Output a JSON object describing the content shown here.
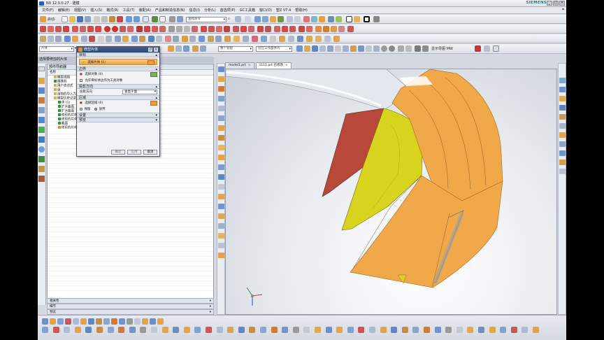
{
  "window": {
    "title": "NX 12.0.0.27 - 建模",
    "brand": "SIEMENS",
    "controls": [
      "_",
      "□",
      "×"
    ]
  },
  "menubar": {
    "items": [
      "文件(F)",
      "编辑(E)",
      "视图(V)",
      "插入(S)",
      "格式(R)",
      "工具(T)",
      "装配(A)",
      "产品和制造信息(N)",
      "信息(I)",
      "分析(L)",
      "首选项(P)",
      "GC工具箱",
      "窗口(O)",
      "塑Z V7.4",
      "帮助(H)"
    ],
    "right_label": "⌗"
  },
  "toolbar1": {
    "start_label": "启动·",
    "find_placeholder": "查找命令",
    "search_glyph": "⌕"
  },
  "toolbar3": {
    "filter_value": "片体",
    "scope_value": "仅在工作部件内",
    "snap_label": "整个装配",
    "view_label": "显示导图 MW"
  },
  "selection_bar": {
    "type_filter": "片体",
    "scope": "整个装配"
  },
  "navigator": {
    "panel_title": "选择要修剪的片体",
    "header": "部件导航器",
    "column_name": "名称",
    "rows": [
      {
        "label": "模型视图",
        "indent": 1,
        "kind": "folder"
      },
      {
        "label": "摄像机",
        "indent": 1,
        "kind": "check"
      },
      {
        "label": "用户表达式",
        "indent": 1,
        "kind": "folder"
      },
      {
        "label": "组",
        "indent": 1,
        "kind": "folder"
      },
      {
        "label": "组档的导入力",
        "indent": 1,
        "kind": "folder"
      },
      {
        "label": "模型历史记录",
        "indent": 1,
        "kind": "folder"
      },
      {
        "label": "体 (1)",
        "indent": 2,
        "kind": "check"
      },
      {
        "label": "扩大曲面",
        "indent": 2,
        "kind": "check"
      },
      {
        "label": "扩大曲面",
        "indent": 2,
        "kind": "check"
      },
      {
        "label": "修剪的片体",
        "indent": 2,
        "kind": "check"
      },
      {
        "label": "修剪的片体",
        "indent": 2,
        "kind": "check"
      },
      {
        "label": "截面",
        "indent": 2,
        "kind": "check"
      },
      {
        "label": "修剪的片体",
        "indent": 2,
        "kind": "fi"
      },
      {
        "label": "修剪片体",
        "indent": 2,
        "kind": "fi"
      },
      {
        "label": "修剪的片体",
        "indent": 2,
        "kind": "check"
      }
    ],
    "footer": [
      "相关性",
      "细节",
      "预览"
    ]
  },
  "dialog": {
    "title": "修剪片体",
    "sections": {
      "target": "目标",
      "boundary": "边界",
      "projection": "投影方向",
      "region": "区域",
      "settings": "设置",
      "preview": "预览"
    },
    "select_sheet": "选择片体 (1)",
    "select_object": "选择对象 (0)",
    "allow_target_edge": "允许目标体边作为工具对象",
    "projection_label": "投影方向",
    "projection_value": "垂直于面",
    "select_region": "选择区域 (0)",
    "keep_label": "保留",
    "discard_label": "放弃",
    "ok": "确定",
    "apply": "应用",
    "cancel": "取消"
  },
  "tabs": [
    {
      "label": "model1.prt",
      "close": "×"
    },
    {
      "label": "1111.prt 已修改",
      "close": "×"
    }
  ],
  "colors": {
    "surface_orange": "#f0a848",
    "surface_orange_dark": "#d9862a",
    "surface_yellow": "#d8d41e",
    "surface_red": "#b8493a",
    "surface_gray": "#dfe4ea",
    "dialog_title": "#2c4a76",
    "selected_row": "#e8a44a"
  }
}
